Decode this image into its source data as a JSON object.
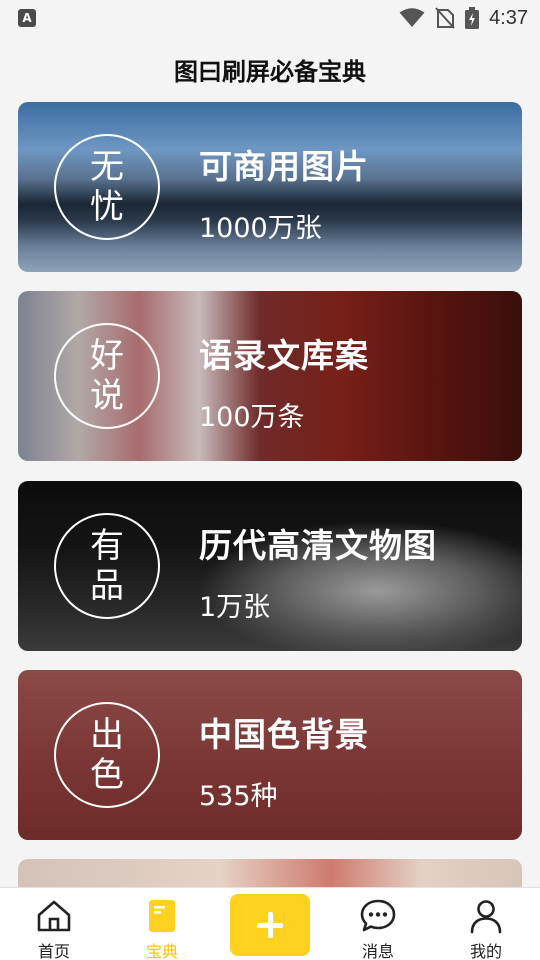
{
  "status_bar": {
    "time": "4:37",
    "left_icon": "keyboard-a-icon",
    "left_icon_letter": "A",
    "icons": [
      "wifi-icon",
      "no-sim-icon",
      "battery-charging-icon"
    ]
  },
  "header": {
    "title": "图曰刷屏必备宝典"
  },
  "cards": [
    {
      "seal": [
        "无",
        "忧"
      ],
      "title": "可商用图片",
      "count": "1000万张"
    },
    {
      "seal": [
        "好",
        "说"
      ],
      "title": "语录文库案",
      "count": "100万条"
    },
    {
      "seal": [
        "有",
        "品"
      ],
      "title": "历代高清文物图",
      "count": "1万张"
    },
    {
      "seal": [
        "出",
        "色"
      ],
      "title": "中国色背景",
      "count": "535种"
    }
  ],
  "tab_bar": {
    "active_color": "#f7c400",
    "add_button_color": "#ffd21f",
    "tabs": [
      {
        "label": "首页",
        "icon": "home-icon"
      },
      {
        "label": "宝典",
        "icon": "book-icon",
        "active": true
      },
      {
        "label": "",
        "icon": "plus-icon"
      },
      {
        "label": "消息",
        "icon": "chat-bubble-icon"
      },
      {
        "label": "我的",
        "icon": "person-icon"
      }
    ]
  }
}
